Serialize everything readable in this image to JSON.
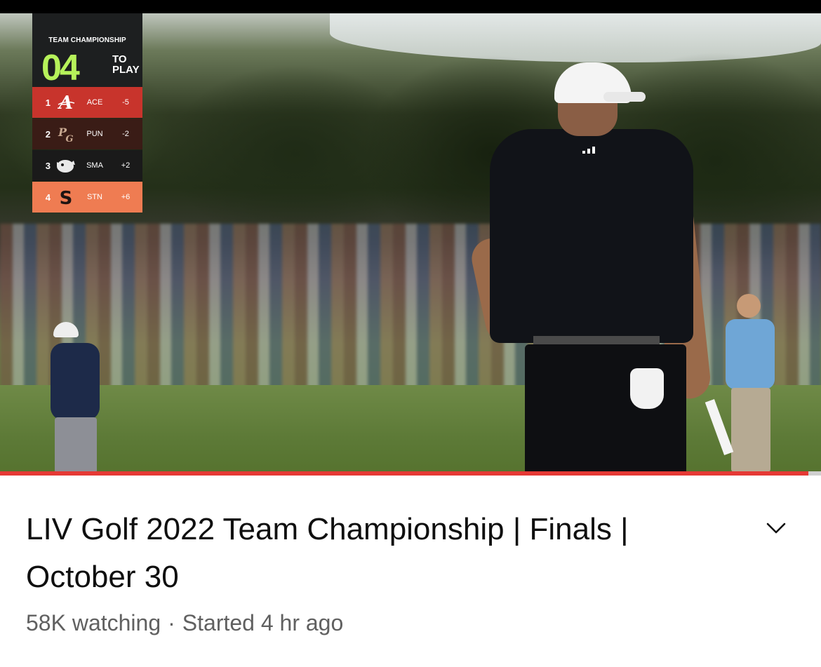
{
  "video": {
    "overlay": {
      "title": "TEAM CHAMPIONSHIP",
      "holes_count": "04",
      "holes_label_line1": "TO",
      "holes_label_line2": "PLAY",
      "teams": [
        {
          "rank": "1",
          "abbr": "ACE",
          "score": "-5",
          "color": "#c8342c",
          "crest_icon": "aces-crest-icon"
        },
        {
          "rank": "2",
          "abbr": "PUN",
          "score": "-2",
          "color": "#3a1c16",
          "crest_icon": "punch-crest-icon"
        },
        {
          "rank": "3",
          "abbr": "SMA",
          "score": "+2",
          "color": "#1a1a1a",
          "crest_icon": "smash-crest-icon"
        },
        {
          "rank": "4",
          "abbr": "STN",
          "score": "+6",
          "color": "#ef7c52",
          "crest_icon": "stinger-crest-icon"
        }
      ]
    },
    "progress_fraction": 0.985,
    "progress_color": "#e53935"
  },
  "title": "LIV Golf 2022 Team Championship | Finals | October 30",
  "meta": {
    "viewers": "58K watching",
    "separator": "·",
    "started": "Started 4 hr ago"
  },
  "icons": {
    "expand": "chevron-down-icon"
  }
}
